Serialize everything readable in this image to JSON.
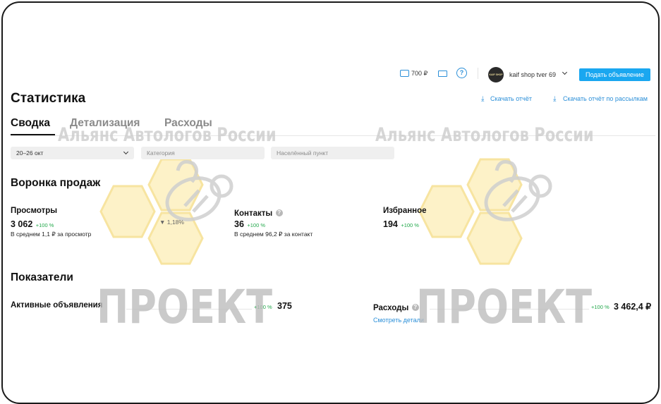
{
  "header": {
    "wallet_amount": "700 ₽",
    "shop_name": "kaif shop tver 69",
    "avatar_text": "KAIF SHOP",
    "post_button": "Подать объявление"
  },
  "page": {
    "title": "Статистика",
    "download_report": "Скачать отчёт",
    "download_mailing_report": "Скачать отчёт по рассылкам",
    "tabs": [
      {
        "label": "Сводка",
        "active": true
      },
      {
        "label": "Детализация",
        "active": false
      },
      {
        "label": "Расходы",
        "active": false
      }
    ]
  },
  "filters": {
    "date_range": "20–26 окт",
    "category_placeholder": "Категория",
    "city_placeholder": "Населённый пункт"
  },
  "funnel": {
    "title": "Воронка продаж",
    "views": {
      "label": "Просмотры",
      "value": "3 062",
      "delta": "+100 %",
      "note": "В среднем 1,1 ₽ за просмотр"
    },
    "conversion": "1,18%",
    "contacts": {
      "label": "Контакты",
      "value": "36",
      "delta": "+100 %",
      "note": "В среднем 96,2 ₽ за контакт"
    },
    "favorites": {
      "label": "Избранное",
      "value": "194",
      "delta": "+100 %"
    }
  },
  "indicators": {
    "title": "Показатели",
    "active_ads": {
      "label": "Активные объявления",
      "delta": "+100 %",
      "value": "375"
    },
    "expenses": {
      "label": "Расходы",
      "delta": "+100 %",
      "value": "3 462,4 ₽",
      "details_link": "Смотреть детали"
    }
  },
  "watermark": {
    "org": "Альянс Автологов России",
    "project": "ПРОЕКТ"
  },
  "colors": {
    "accent": "#1aa7f0",
    "link": "#2b8fd8",
    "positive": "#22a84b",
    "honeycomb": "#fdf0c4"
  }
}
